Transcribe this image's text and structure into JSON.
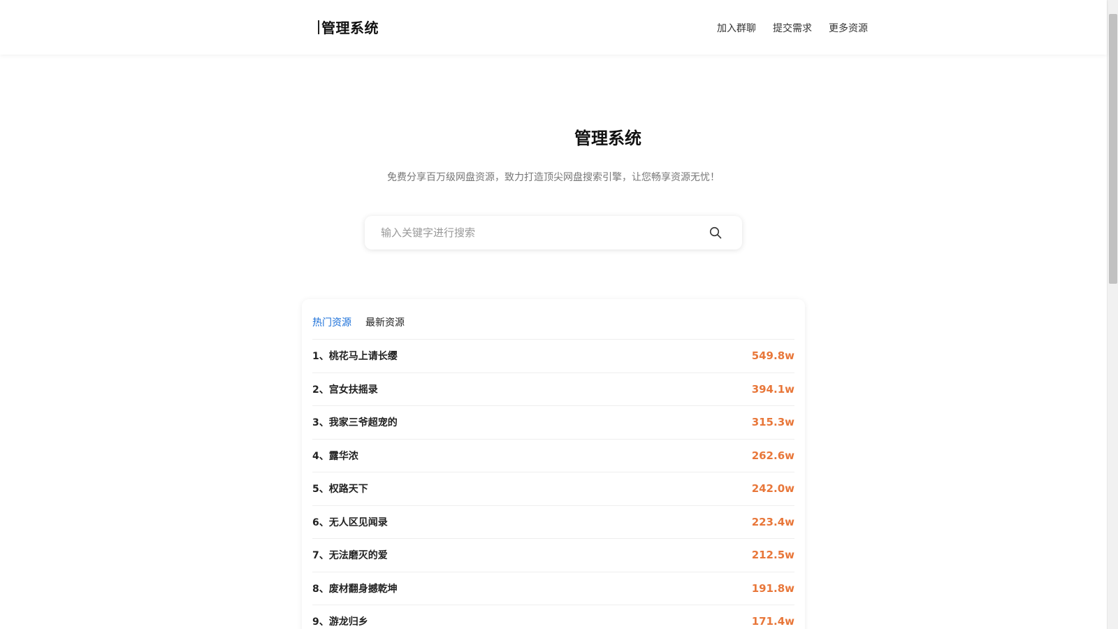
{
  "header": {
    "title": "管理系统",
    "nav": [
      "加入群聊",
      "提交需求",
      "更多资源"
    ]
  },
  "hero": {
    "title": "管理系统",
    "subtitle": "免费分享百万级网盘资源，致力打造顶尖网盘搜索引擎，让您畅享资源无忧！"
  },
  "search": {
    "placeholder": "输入关键字进行搜索",
    "icon": "search-icon"
  },
  "tabs": {
    "hot": "热门资源",
    "latest": "最新资源",
    "active": "hot"
  },
  "hot_list": [
    {
      "title": "1、桃花马上请长缨",
      "count": "549.8w"
    },
    {
      "title": "2、宫女扶摇录",
      "count": "394.1w"
    },
    {
      "title": "3、我家三爷超宠的",
      "count": "315.3w"
    },
    {
      "title": "4、露华浓",
      "count": "262.6w"
    },
    {
      "title": "5、权路天下",
      "count": "242.0w"
    },
    {
      "title": "6、无人区见闻录",
      "count": "223.4w"
    },
    {
      "title": "7、无法磨灭的爱",
      "count": "212.5w"
    },
    {
      "title": "8、废材翻身撼乾坤",
      "count": "191.8w"
    },
    {
      "title": "9、游龙归乡",
      "count": "171.4w"
    }
  ],
  "colors": {
    "accent": "#1a6fd8",
    "count": "#e8773a"
  }
}
